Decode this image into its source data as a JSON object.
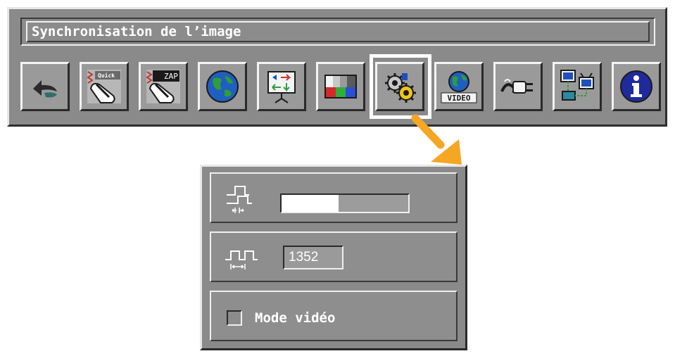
{
  "window": {
    "title": "Synchronisation de l’image"
  },
  "toolbar": {
    "buttons": [
      {
        "name": "back-icon",
        "label": ""
      },
      {
        "name": "quick-remote-icon",
        "label": "Quick"
      },
      {
        "name": "zap-remote-icon",
        "label": "ZAP"
      },
      {
        "name": "globe-icon",
        "label": ""
      },
      {
        "name": "presentation-icon",
        "label": ""
      },
      {
        "name": "color-bars-icon",
        "label": ""
      },
      {
        "name": "gears-icon",
        "label": ""
      },
      {
        "name": "video-globe-icon",
        "label": "VIDEO"
      },
      {
        "name": "power-plug-icon",
        "label": ""
      },
      {
        "name": "pc-tv-network-icon",
        "label": ""
      },
      {
        "name": "info-icon",
        "label": ""
      }
    ],
    "selected_index": 6
  },
  "panel": {
    "phase": {
      "icon": "phase-pulse-icon",
      "slider_fraction": 0.45
    },
    "frequency": {
      "icon": "period-pulse-icon",
      "value": "1352"
    },
    "video_mode": {
      "label": "Mode vidéo",
      "checked": false
    }
  },
  "colors": {
    "panel_gray": "#8a8a8a",
    "highlight": "#ffffff",
    "arrow": "#f5a623",
    "info_blue": "#1f2b9c"
  }
}
